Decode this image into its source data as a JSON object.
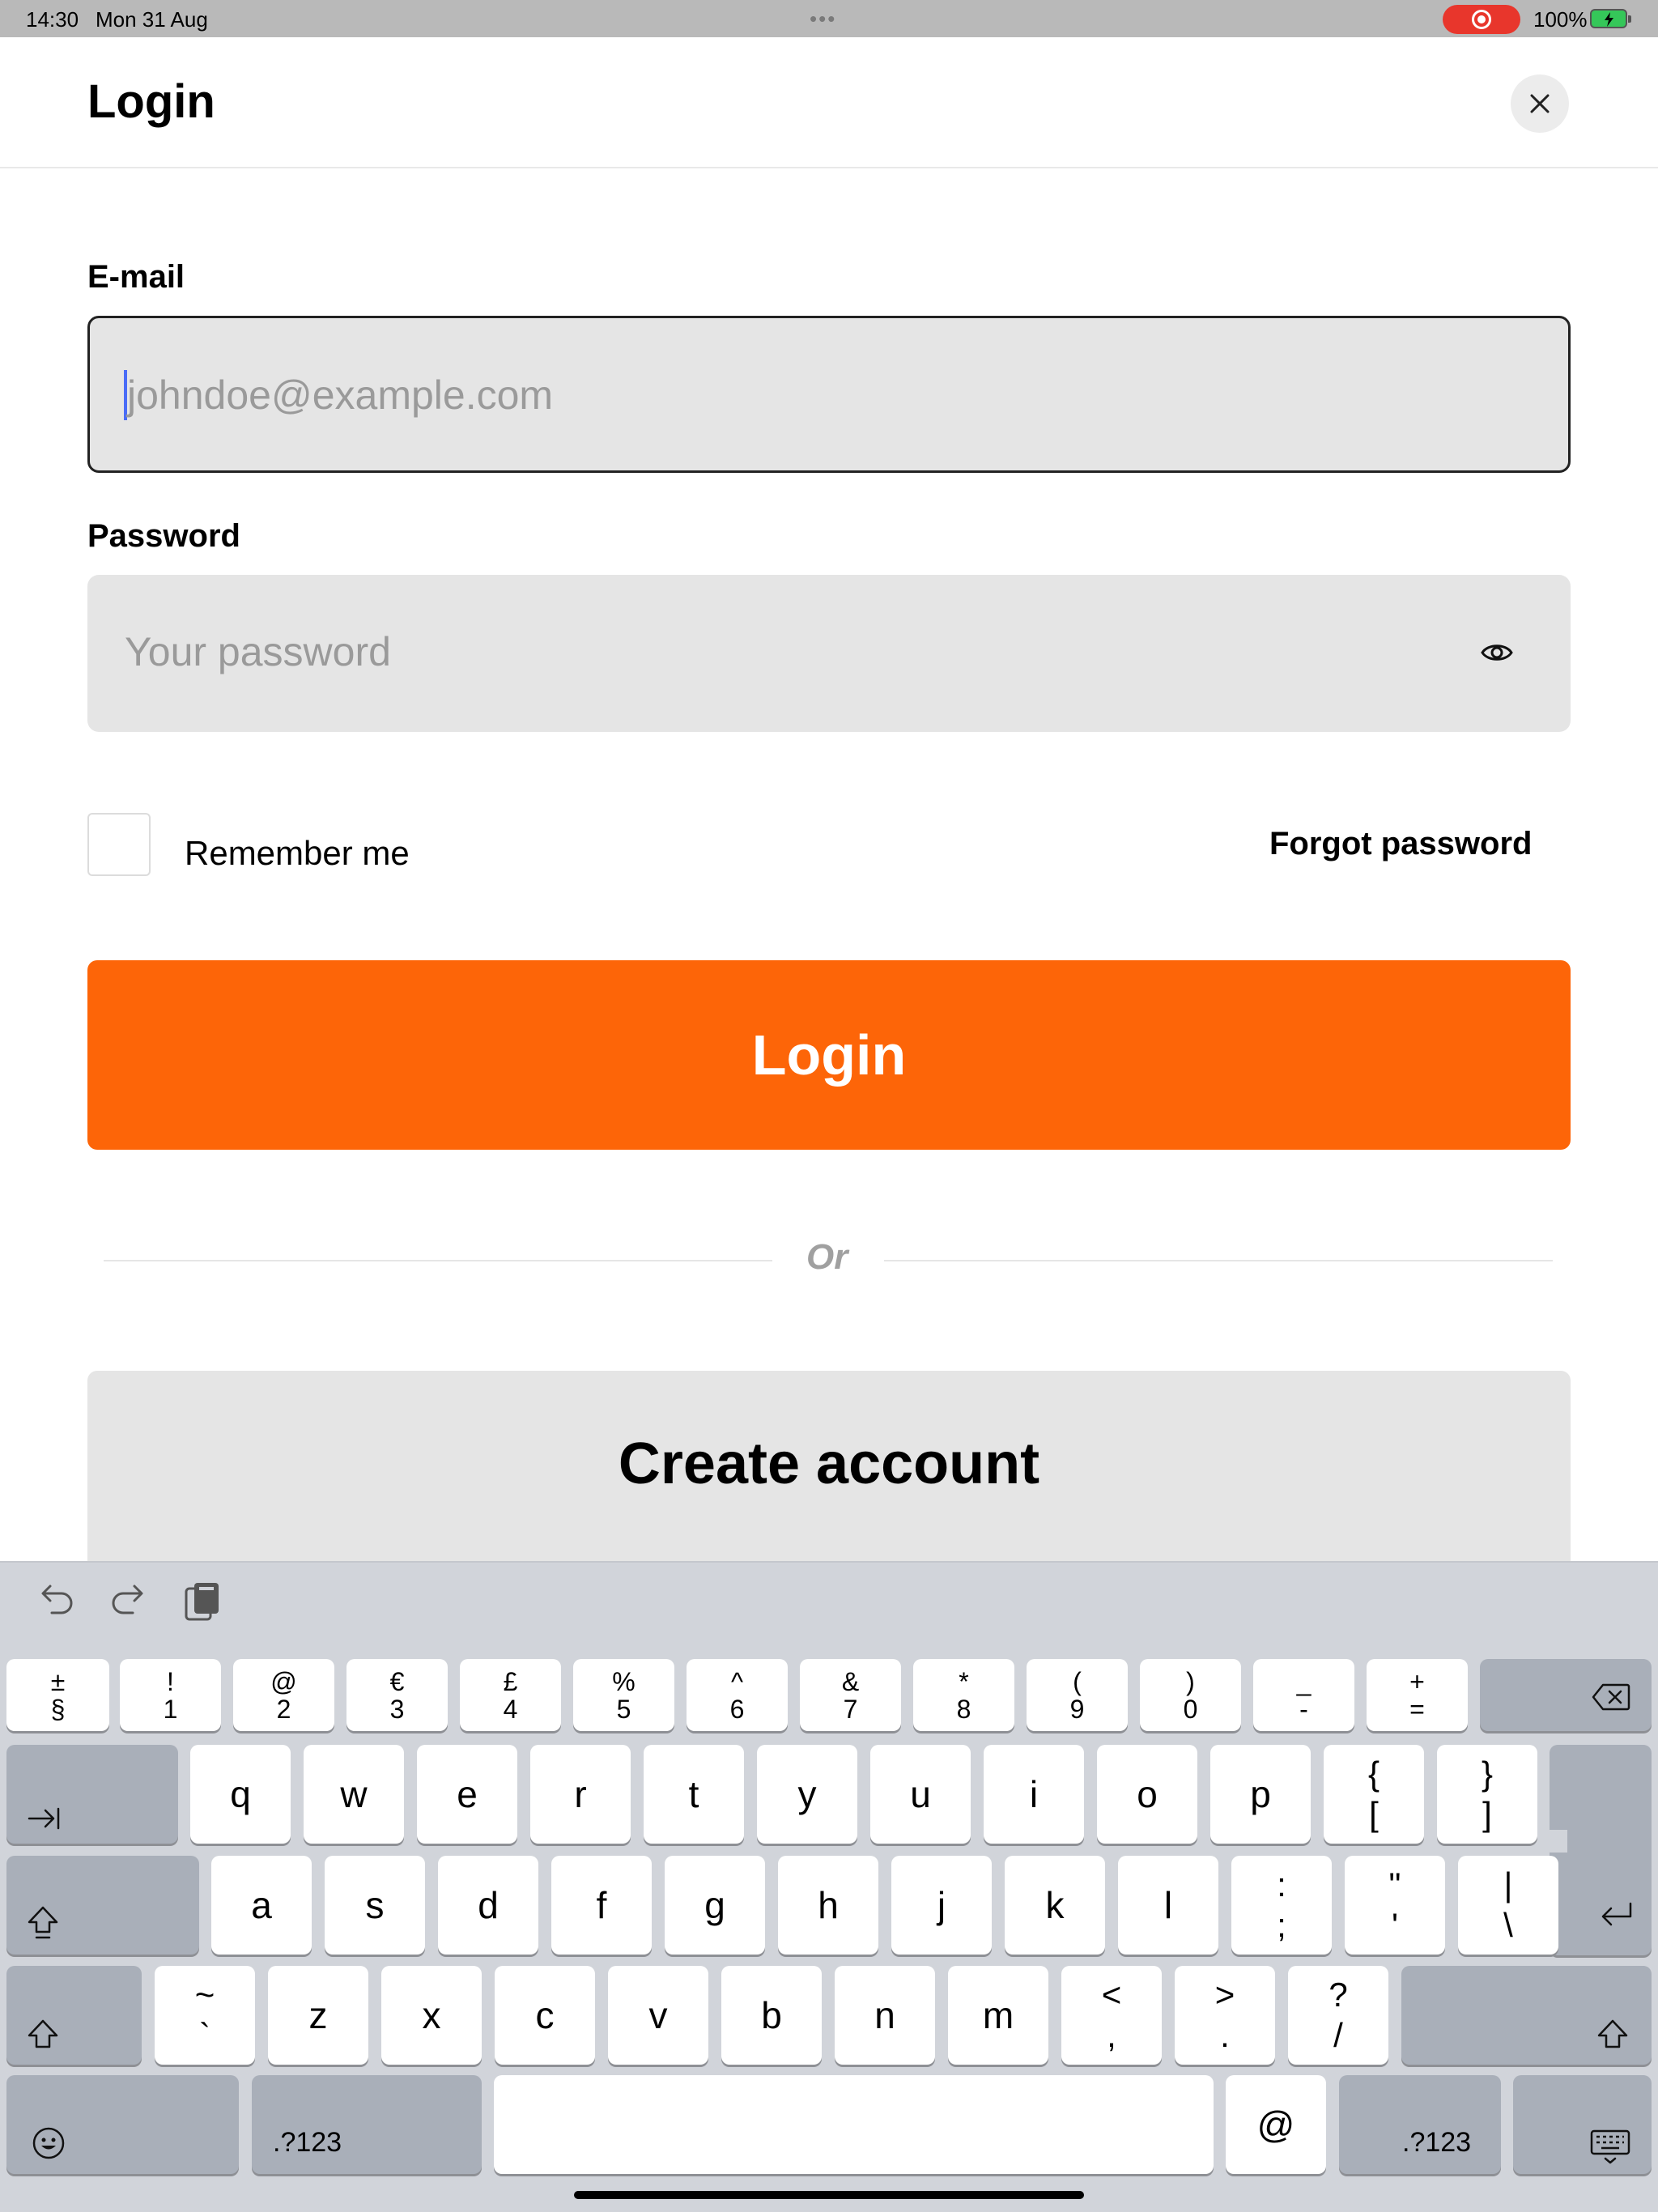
{
  "status_bar": {
    "time": "14:30",
    "date": "Mon 31 Aug",
    "battery": "100%"
  },
  "header": {
    "title": "Login"
  },
  "email": {
    "label": "E-mail",
    "placeholder": "johndoe@example.com"
  },
  "password": {
    "label": "Password",
    "placeholder": "Your password"
  },
  "remember_label": "Remember me",
  "forgot_label": "Forgot password",
  "login_button": "Login",
  "divider_text": "Or",
  "create_account_button": "Create account",
  "colors": {
    "accent": "#fd6508",
    "field_bg": "#e5e5e5",
    "keyboard_bg": "#d1d4da"
  },
  "keyboard": {
    "number_row": [
      {
        "top": "±",
        "bot": "§"
      },
      {
        "top": "!",
        "bot": "1"
      },
      {
        "top": "@",
        "bot": "2"
      },
      {
        "top": "€",
        "bot": "3"
      },
      {
        "top": "£",
        "bot": "4"
      },
      {
        "top": "%",
        "bot": "5"
      },
      {
        "top": "^",
        "bot": "6"
      },
      {
        "top": "&",
        "bot": "7"
      },
      {
        "top": "*",
        "bot": "8"
      },
      {
        "top": "(",
        "bot": "9"
      },
      {
        "top": ")",
        "bot": "0"
      },
      {
        "top": "_",
        "bot": "-"
      },
      {
        "top": "+",
        "bot": "="
      }
    ],
    "row_q": [
      "q",
      "w",
      "e",
      "r",
      "t",
      "y",
      "u",
      "i",
      "o",
      "p"
    ],
    "row_q_brackets": [
      {
        "top": "{",
        "bot": "["
      },
      {
        "top": "}",
        "bot": "]"
      }
    ],
    "row_a": [
      "a",
      "s",
      "d",
      "f",
      "g",
      "h",
      "j",
      "k",
      "l"
    ],
    "row_a_punct": [
      {
        "top": ":",
        "bot": ";"
      },
      {
        "top": "\"",
        "bot": "'"
      },
      {
        "top": "|",
        "bot": "\\"
      }
    ],
    "tilde_key": {
      "top": "~",
      "bot": "`"
    },
    "row_z": [
      "z",
      "x",
      "c",
      "v",
      "b",
      "n",
      "m"
    ],
    "row_z_punct": [
      {
        "top": "<",
        "bot": ","
      },
      {
        "top": ">",
        "bot": "."
      },
      {
        "top": "?",
        "bot": "/"
      }
    ],
    "numbers_label": ".?123",
    "at_key": "@"
  }
}
